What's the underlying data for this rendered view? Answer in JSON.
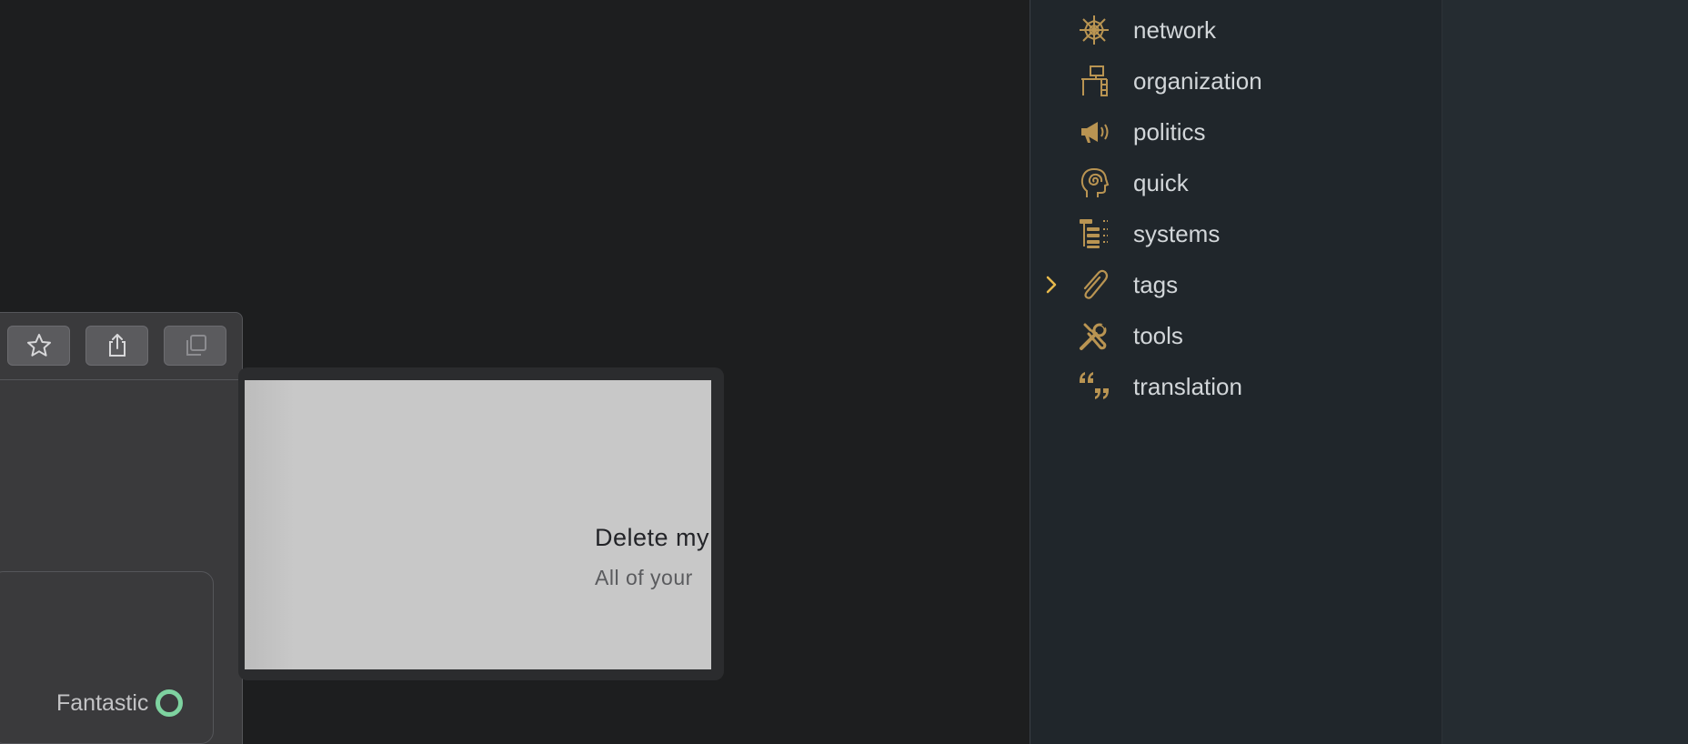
{
  "left_panel": {
    "toolbar": [
      {
        "name": "favorite-button",
        "icon": "star-icon"
      },
      {
        "name": "share-button",
        "icon": "share-icon"
      },
      {
        "name": "duplicate-button",
        "icon": "copy-icon"
      }
    ],
    "status_label": "Fantastic"
  },
  "dialog": {
    "title": "Delete my",
    "subtitle": "All of your"
  },
  "sidebar": {
    "items": [
      {
        "label": "network",
        "icon": "spider-web-icon"
      },
      {
        "label": "organization",
        "icon": "desk-icon"
      },
      {
        "label": "politics",
        "icon": "megaphone-icon"
      },
      {
        "label": "quick",
        "icon": "head-spiral-icon"
      },
      {
        "label": "systems",
        "icon": "tree-hierarchy-icon"
      },
      {
        "label": "tags",
        "icon": "paperclip-icon",
        "collapsed": true
      },
      {
        "label": "tools",
        "icon": "wrench-screwdriver-icon"
      },
      {
        "label": "translation",
        "icon": "quote-icon"
      }
    ]
  },
  "colors": {
    "accent_icon": "#b99452",
    "chevron": "#e7b94c",
    "status_ring": "#7ed3a0"
  }
}
